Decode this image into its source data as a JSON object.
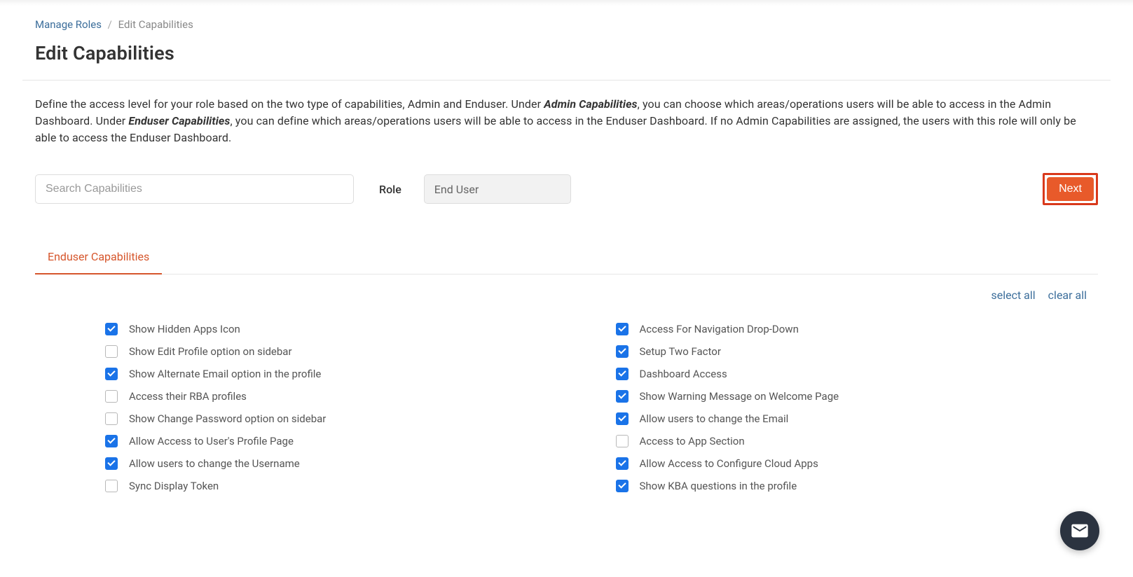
{
  "breadcrumb": {
    "root": "Manage Roles",
    "current": "Edit Capabilities"
  },
  "page_title": "Edit Capabilities",
  "description": {
    "part1": "Define the access level for your role based on the two type of capabilities, Admin and Enduser. Under ",
    "bold1": "Admin Capabilities",
    "part2": ", you can choose which areas/operations users will be able to access in the Admin Dashboard. Under ",
    "bold2": "Enduser Capabilities",
    "part3": ", you can define which areas/operations users will be able to access in the Enduser Dashboard. If no Admin Capabilities are assigned, the users with this role will only be able to access the Enduser Dashboard."
  },
  "search": {
    "placeholder": "Search Capabilities"
  },
  "role": {
    "label": "Role",
    "value": "End User"
  },
  "next_label": "Next",
  "tab": {
    "label": "Enduser Capabilities"
  },
  "actions": {
    "select_all": "select all",
    "clear_all": "clear all"
  },
  "capabilities_left": [
    {
      "label": "Show Hidden Apps Icon",
      "checked": true
    },
    {
      "label": "Show Edit Profile option on sidebar",
      "checked": false
    },
    {
      "label": "Show Alternate Email option in the profile",
      "checked": true
    },
    {
      "label": "Access their RBA profiles",
      "checked": false
    },
    {
      "label": "Show Change Password option on sidebar",
      "checked": false
    },
    {
      "label": "Allow Access to User's Profile Page",
      "checked": true
    },
    {
      "label": "Allow users to change the Username",
      "checked": true
    },
    {
      "label": "Sync Display Token",
      "checked": false
    }
  ],
  "capabilities_right": [
    {
      "label": "Access For Navigation Drop-Down",
      "checked": true
    },
    {
      "label": "Setup Two Factor",
      "checked": true
    },
    {
      "label": "Dashboard Access",
      "checked": true
    },
    {
      "label": "Show Warning Message on Welcome Page",
      "checked": true
    },
    {
      "label": "Allow users to change the Email",
      "checked": true
    },
    {
      "label": "Access to App Section",
      "checked": false
    },
    {
      "label": "Allow Access to Configure Cloud Apps",
      "checked": true
    },
    {
      "label": "Show KBA questions in the profile",
      "checked": true
    }
  ]
}
